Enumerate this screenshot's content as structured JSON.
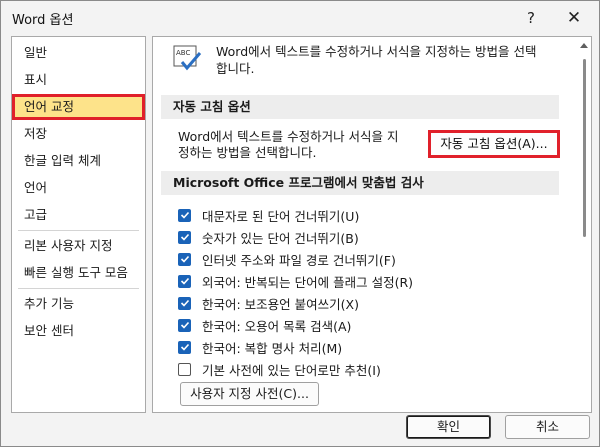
{
  "window": {
    "title": "Word 옵션",
    "help_icon": "question-mark-icon",
    "help_label": "?",
    "close_icon": "close-icon",
    "close_label": "✕"
  },
  "sidebar": {
    "items": [
      {
        "label": "일반"
      },
      {
        "label": "표시"
      },
      {
        "label": "언어 교정",
        "selected": true
      },
      {
        "label": "저장"
      },
      {
        "label": "한글 입력 체계"
      },
      {
        "label": "언어"
      },
      {
        "label": "고급"
      },
      {
        "label": "리본 사용자 지정"
      },
      {
        "label": "빠른 실행 도구 모음"
      },
      {
        "label": "추가 기능"
      },
      {
        "label": "보안 센터"
      }
    ]
  },
  "main": {
    "intro_icon": "proofing-abc-check-icon",
    "intro_text": "Word에서 텍스트를 수정하거나 서식을 지정하는 방법을 선택합니다.",
    "autocorrect_section": {
      "heading": "자동 고침 옵션",
      "description": "Word에서 텍스트를 수정하거나 서식을 지정하는 방법을 선택합니다.",
      "button_label": "자동 고침 옵션(A)..."
    },
    "spelling_section": {
      "heading": "Microsoft Office 프로그램에서 맞춤법 검사",
      "options": [
        {
          "label": "대문자로 된 단어 건너뛰기(U)",
          "checked": true
        },
        {
          "label": "숫자가 있는 단어 건너뛰기(B)",
          "checked": true
        },
        {
          "label": "인터넷 주소와 파일 경로 건너뛰기(F)",
          "checked": true
        },
        {
          "label": "외국어: 반복되는 단어에 플래그 설정(R)",
          "checked": true
        },
        {
          "label": "한국어: 보조용언 붙여쓰기(X)",
          "checked": true
        },
        {
          "label": "한국어: 오용어 목록 검색(A)",
          "checked": true
        },
        {
          "label": "한국어: 복합 명사 처리(M)",
          "checked": true
        },
        {
          "label": "기본 사전에 있는 단어로만 추천(I)",
          "checked": false
        }
      ],
      "custom_dict_button": "사용자 지정 사전(C)..."
    }
  },
  "footer": {
    "ok_label": "확인",
    "cancel_label": "취소"
  },
  "colors": {
    "selected_bg": "#fde38a",
    "highlight_border": "#e0202a",
    "checkbox_blue": "#1a63b8"
  }
}
